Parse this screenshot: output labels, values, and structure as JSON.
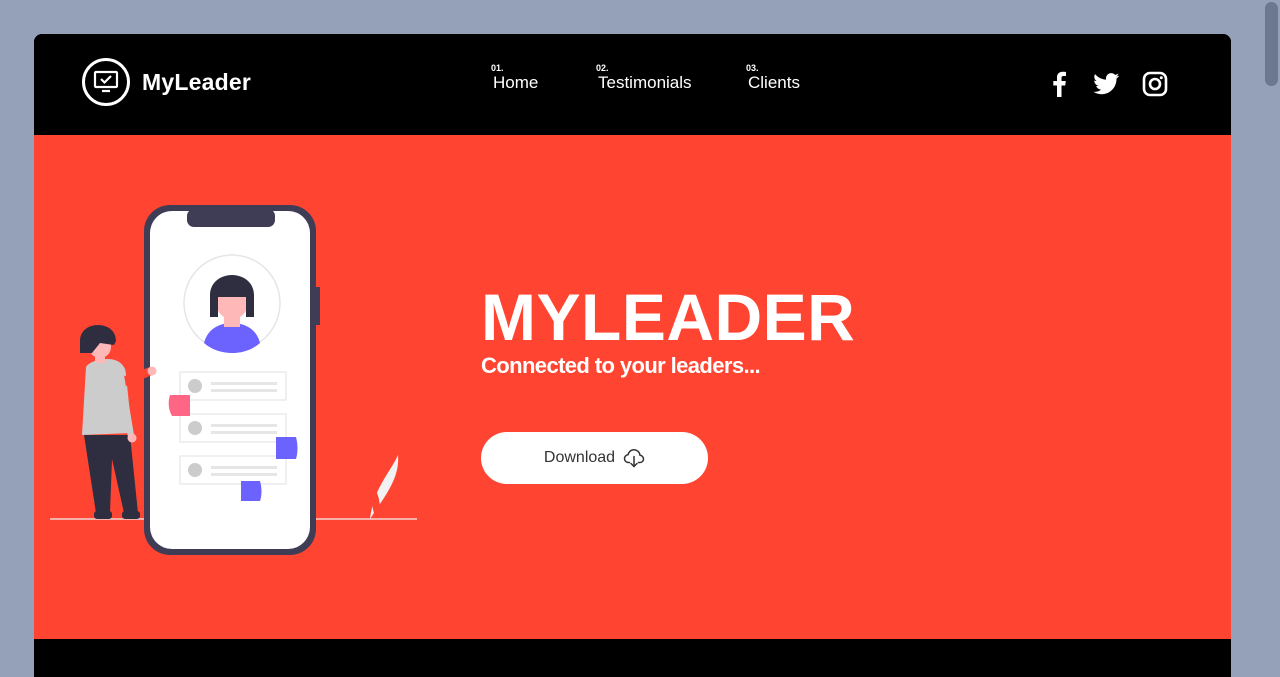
{
  "brand": {
    "name": "MyLeader",
    "logo_icon": "monitor-check-icon"
  },
  "nav": [
    {
      "num": "01.",
      "label": "Home"
    },
    {
      "num": "02.",
      "label": "Testimonials"
    },
    {
      "num": "03.",
      "label": "Clients"
    }
  ],
  "social": [
    "facebook-icon",
    "twitter-icon",
    "instagram-icon"
  ],
  "hero": {
    "title": "MYLEADER",
    "subtitle": "Connected to your leaders...",
    "download_label": "Download",
    "download_icon": "cloud-download-icon"
  },
  "colors": {
    "accent": "#ff4532",
    "navbar": "#000000",
    "background": "#94a1b8",
    "button": "#ffffff",
    "illustration_purple": "#6c63ff",
    "illustration_pink": "#ff6584",
    "phone_frame": "#3f3d56"
  }
}
